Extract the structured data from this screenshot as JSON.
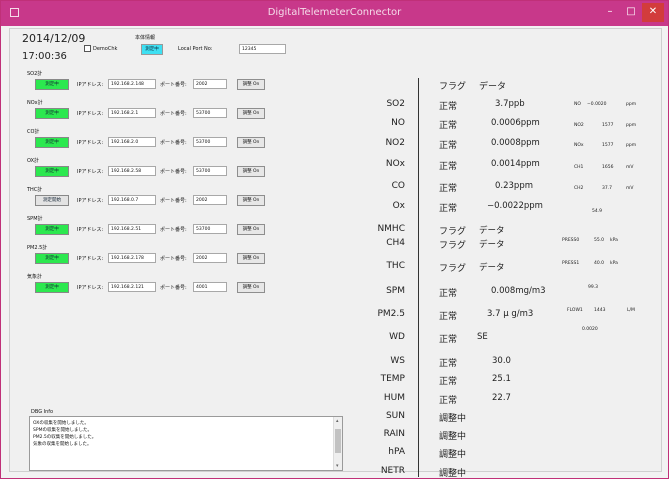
{
  "window": {
    "title": "DigitalTelemeterConnector",
    "min": "–",
    "max": "□",
    "close": "✕"
  },
  "header": {
    "date": "2014/12/09",
    "time": "17:00:36",
    "demo_label": "DemoChk",
    "unit_info_label": "本体情報",
    "unit_status": "測定中",
    "local_port_label": "Local Port No:",
    "local_port_value": "12345"
  },
  "instrument_labels": {
    "ip": "IPアドレス:",
    "port": "ポート番号:",
    "button": "調整 On"
  },
  "instruments": [
    {
      "name": "SO2計",
      "status": "測定中",
      "active": true,
      "ip": "192.168.2.148",
      "port": "2002"
    },
    {
      "name": "NOx計",
      "status": "測定中",
      "active": true,
      "ip": "192.168.2.1",
      "port": "53700"
    },
    {
      "name": "CO計",
      "status": "測定中",
      "active": true,
      "ip": "192.168.2.0",
      "port": "53700"
    },
    {
      "name": "OX計",
      "status": "測定中",
      "active": true,
      "ip": "192.168.2.58",
      "port": "53700"
    },
    {
      "name": "THC計",
      "status": "測定開始",
      "active": false,
      "ip": "192.168.0.7",
      "port": "2002"
    },
    {
      "name": "SPM計",
      "status": "測定中",
      "active": true,
      "ip": "192.168.2.51",
      "port": "53700"
    },
    {
      "name": "PM2.5計",
      "status": "測定中",
      "active": true,
      "ip": "192.168.2.178",
      "port": "2002"
    },
    {
      "name": "気象計",
      "status": "測定中",
      "active": true,
      "ip": "192.168.2.121",
      "port": "4001"
    }
  ],
  "dbg": {
    "title": "DBG Info",
    "lines": [
      "OXの収集を開始しました。",
      "SPMの収集を開始しました。",
      "PM2.5の収集を開始しました。",
      "気象の収集を開始しました。"
    ]
  },
  "table": {
    "headers": {
      "flag": "フラグ",
      "data": "データ"
    },
    "rows": [
      {
        "param": "SO2",
        "flag": "正常",
        "value": "3.7ppb"
      },
      {
        "param": "NO",
        "flag": "正常",
        "value": "0.0006ppm"
      },
      {
        "param": "NO2",
        "flag": "正常",
        "value": "0.0008ppm"
      },
      {
        "param": "NOx",
        "flag": "正常",
        "value": "0.0014ppm"
      },
      {
        "param": "CO",
        "flag": "正常",
        "value": "0.23ppm"
      },
      {
        "param": "Ox",
        "flag": "正常",
        "value": "−0.0022ppm"
      },
      {
        "param": "NMHC",
        "flag": "フラグ",
        "value": "データ"
      },
      {
        "param": "CH4",
        "flag": "フラグ",
        "value": "データ"
      },
      {
        "param": "THC",
        "flag": "フラグ",
        "value": "データ"
      },
      {
        "param": "SPM",
        "flag": "正常",
        "value": "0.008mg/m3"
      },
      {
        "param": "PM2.5",
        "flag": "正常",
        "value": "3.7 μ g/m3"
      },
      {
        "param": "WD",
        "flag": "正常",
        "value": "SE"
      },
      {
        "param": "WS",
        "flag": "正常",
        "value": "30.0"
      },
      {
        "param": "TEMP",
        "flag": "正常",
        "value": "25.1"
      },
      {
        "param": "HUM",
        "flag": "正常",
        "value": "22.7"
      },
      {
        "param": "SUN",
        "flag": "調整中",
        "value": ""
      },
      {
        "param": "RAIN",
        "flag": "調整中",
        "value": ""
      },
      {
        "param": "hPA",
        "flag": "調整中",
        "value": ""
      },
      {
        "param": "NETR",
        "flag": "調整中",
        "value": ""
      }
    ]
  },
  "aux": {
    "no": {
      "label": "NO",
      "value": "−0.0020",
      "unit": "ppm"
    },
    "no2": {
      "label": "NO2",
      "value": "1577",
      "unit": "ppm"
    },
    "nox": {
      "label": "NOx",
      "value": "1577",
      "unit": "ppm"
    },
    "ch1": {
      "label": "CH1",
      "value": "1656",
      "unit": "mV"
    },
    "ch2": {
      "label": "CH2",
      "value": "37.7",
      "unit": "mV"
    },
    "v549": "54.9",
    "press0": {
      "label": "PRESS0",
      "value": "55.0",
      "unit": "kPa"
    },
    "press1": {
      "label": "PRESS1",
      "value": "40.0",
      "unit": "kPa"
    },
    "v993": "99.3",
    "flow1": {
      "label": "FLOW1",
      "value": "1443",
      "unit": "L/M"
    },
    "v0020": "0.0020"
  }
}
